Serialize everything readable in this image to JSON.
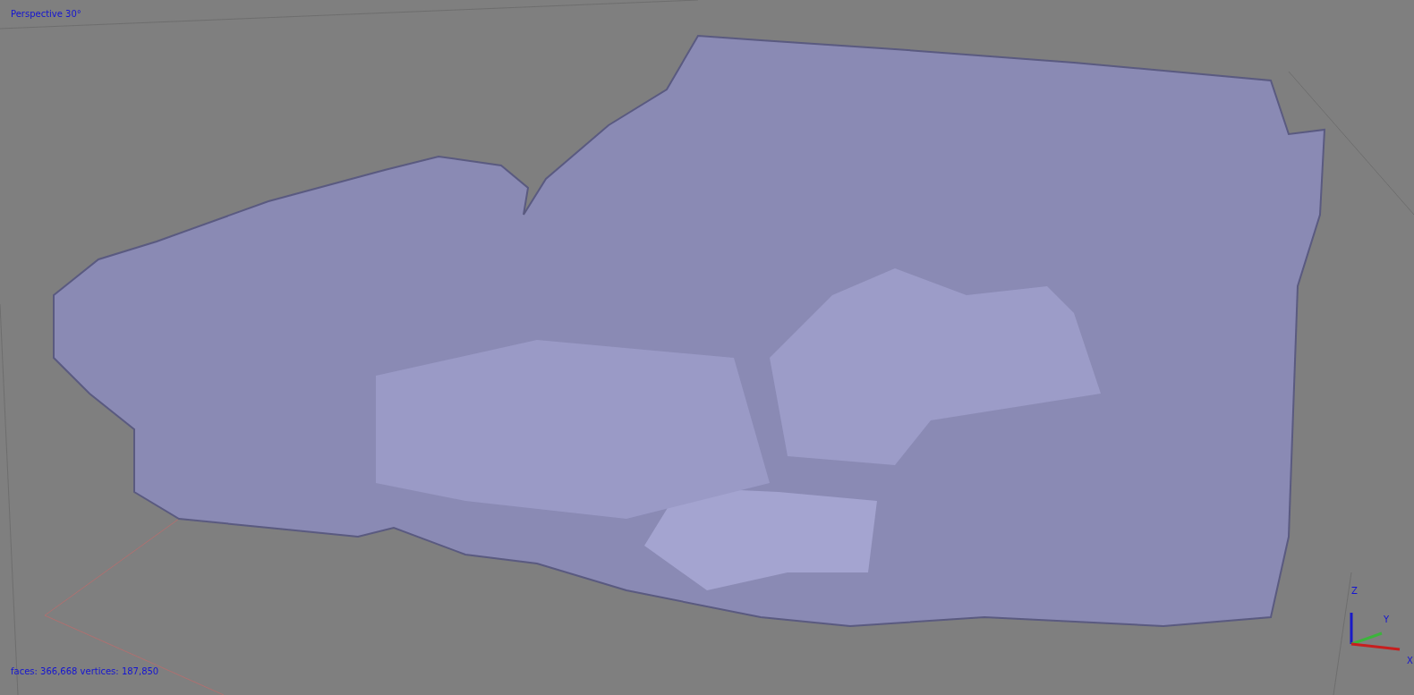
{
  "viewport": {
    "projection_label": "Perspective 30°",
    "stats": "faces: 366,668 vertices: 187,850"
  },
  "axis_gizmo": {
    "labels": [
      "Z",
      "Y",
      "X"
    ]
  }
}
